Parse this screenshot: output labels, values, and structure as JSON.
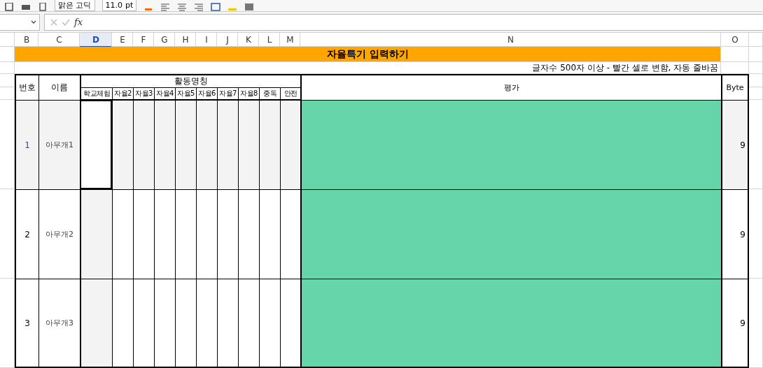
{
  "toolbar": {
    "font_name": "맑은 고딕",
    "font_size": "11.0",
    "size_unit": "pt"
  },
  "formula_bar": {
    "function_symbol": "fx"
  },
  "columns": [
    {
      "label": "B",
      "selected": false
    },
    {
      "label": "C",
      "selected": false
    },
    {
      "label": "D",
      "selected": true
    },
    {
      "label": "E",
      "selected": false
    },
    {
      "label": "F",
      "selected": false
    },
    {
      "label": "G",
      "selected": false
    },
    {
      "label": "H",
      "selected": false
    },
    {
      "label": "I",
      "selected": false
    },
    {
      "label": "J",
      "selected": false
    },
    {
      "label": "K",
      "selected": false
    },
    {
      "label": "L",
      "selected": false
    },
    {
      "label": "M",
      "selected": false
    },
    {
      "label": "N",
      "selected": false
    },
    {
      "label": "O",
      "selected": false
    }
  ],
  "title": "자율특기 입력하기",
  "note": "글자수 500자 이상 - 빨간 셀로 변함, 자동 줄바꿈",
  "headers": {
    "number": "번호",
    "name": "이름",
    "activities": "활동명칭",
    "evaluation": "평가",
    "bytes": "Byte"
  },
  "activities": [
    "학교체험",
    "자율2",
    "자율3",
    "자율4",
    "자율5",
    "자율6",
    "자율7",
    "자율8",
    "중독",
    "안전"
  ],
  "rows": [
    {
      "number": "1",
      "name": "아무개1",
      "bytes": "9",
      "selected": true
    },
    {
      "number": "2",
      "name": "아무개2",
      "bytes": "9",
      "selected": false
    },
    {
      "number": "3",
      "name": "아무개3",
      "bytes": "9",
      "selected": false
    }
  ]
}
